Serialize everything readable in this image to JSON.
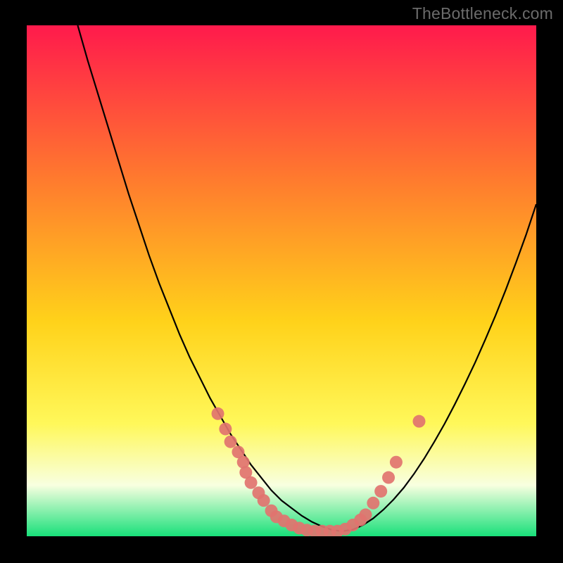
{
  "watermark": "TheBottleneck.com",
  "colors": {
    "black": "#000000",
    "curve": "#000000",
    "markerFill": "#e1736f",
    "markerStroke": "#d8655f",
    "gradientTop": "#ff1a4c",
    "gradientUpperMid": "#ff7a2e",
    "gradientMid": "#ffd21a",
    "gradientYellowBand": "#fff85a",
    "gradientPaleBand": "#f8ffe0",
    "gradientGreenBottom": "#18e07a"
  },
  "chart_data": {
    "type": "line",
    "title": "",
    "xlabel": "",
    "ylabel": "",
    "xlim": [
      0,
      100
    ],
    "ylim": [
      0,
      100
    ],
    "series": [
      {
        "name": "bottleneck-curve",
        "x": [
          10,
          12,
          14,
          16,
          18,
          20,
          22,
          24,
          26,
          28,
          30,
          32,
          34,
          36,
          38,
          40,
          42,
          44,
          46,
          48,
          50,
          52,
          54,
          56,
          58,
          60,
          62,
          64,
          66,
          68,
          70,
          72,
          74,
          76,
          78,
          80,
          82,
          84,
          86,
          88,
          90,
          92,
          94,
          96,
          98,
          100
        ],
        "y": [
          100,
          93,
          86.5,
          80,
          73.5,
          67,
          61,
          55,
          49.5,
          44.5,
          39.5,
          35,
          31,
          27,
          23.5,
          20,
          17,
          14,
          11.5,
          9,
          7,
          5.5,
          4,
          2.8,
          1.9,
          1.2,
          1,
          1.3,
          2.2,
          3.5,
          5.2,
          7.2,
          9.5,
          12.2,
          15.2,
          18.5,
          22,
          25.8,
          29.8,
          34,
          38.5,
          43.2,
          48.2,
          53.5,
          59,
          65
        ]
      }
    ],
    "markers": [
      {
        "x": 37.5,
        "y": 24.0
      },
      {
        "x": 39.0,
        "y": 21.0
      },
      {
        "x": 40.0,
        "y": 18.5
      },
      {
        "x": 41.5,
        "y": 16.5
      },
      {
        "x": 42.5,
        "y": 14.5
      },
      {
        "x": 43.0,
        "y": 12.5
      },
      {
        "x": 44.0,
        "y": 10.5
      },
      {
        "x": 45.5,
        "y": 8.5
      },
      {
        "x": 46.5,
        "y": 7.0
      },
      {
        "x": 48.0,
        "y": 5.0
      },
      {
        "x": 49.0,
        "y": 3.8
      },
      {
        "x": 50.5,
        "y": 3.0
      },
      {
        "x": 52.0,
        "y": 2.2
      },
      {
        "x": 53.5,
        "y": 1.6
      },
      {
        "x": 55.0,
        "y": 1.2
      },
      {
        "x": 56.5,
        "y": 1.0
      },
      {
        "x": 58.0,
        "y": 1.0
      },
      {
        "x": 59.5,
        "y": 1.0
      },
      {
        "x": 61.0,
        "y": 1.0
      },
      {
        "x": 62.5,
        "y": 1.4
      },
      {
        "x": 64.0,
        "y": 2.2
      },
      {
        "x": 65.5,
        "y": 3.2
      },
      {
        "x": 66.5,
        "y": 4.2
      },
      {
        "x": 68.0,
        "y": 6.5
      },
      {
        "x": 69.5,
        "y": 8.8
      },
      {
        "x": 71.0,
        "y": 11.5
      },
      {
        "x": 72.5,
        "y": 14.5
      },
      {
        "x": 77.0,
        "y": 22.5
      }
    ],
    "gradient_stops": [
      {
        "pos": 0.0,
        "color": "#ff1a4c"
      },
      {
        "pos": 0.3,
        "color": "#ff7a2e"
      },
      {
        "pos": 0.58,
        "color": "#ffd21a"
      },
      {
        "pos": 0.78,
        "color": "#fff85a"
      },
      {
        "pos": 0.9,
        "color": "#f8ffe0"
      },
      {
        "pos": 1.0,
        "color": "#18e07a"
      }
    ]
  }
}
